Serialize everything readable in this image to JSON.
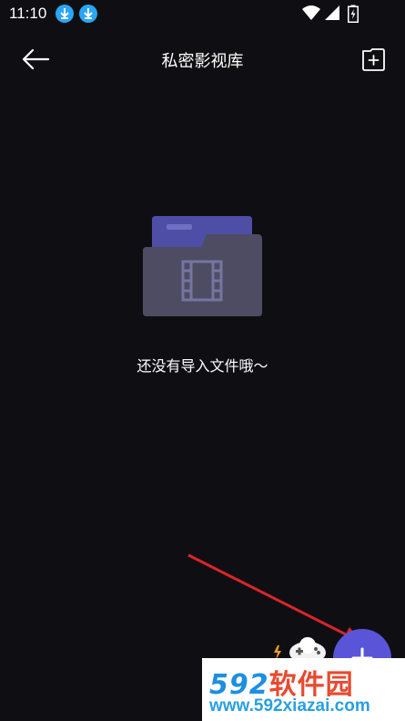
{
  "status_bar": {
    "time": "11:10",
    "icons": [
      "download-icon",
      "download-icon",
      "wifi-icon",
      "signal-icon",
      "battery-charging-icon"
    ]
  },
  "app_bar": {
    "title": "私密影视库",
    "back_icon": "back-arrow-icon",
    "action_icon": "add-folder-icon"
  },
  "empty_state": {
    "message": "还没有导入文件哦～",
    "icon": "film-folder-icon"
  },
  "fab": {
    "icon": "plus-icon"
  },
  "watermark": {
    "brand_num": "592",
    "brand_cn": "软件园",
    "url": "www.592xiazai.com"
  },
  "colors": {
    "background": "#0f0f13",
    "accent": "#5a55d8",
    "folder_back": "#4f4ea6",
    "folder_front": "#4d4c63",
    "annotation_arrow": "#d8262a"
  }
}
